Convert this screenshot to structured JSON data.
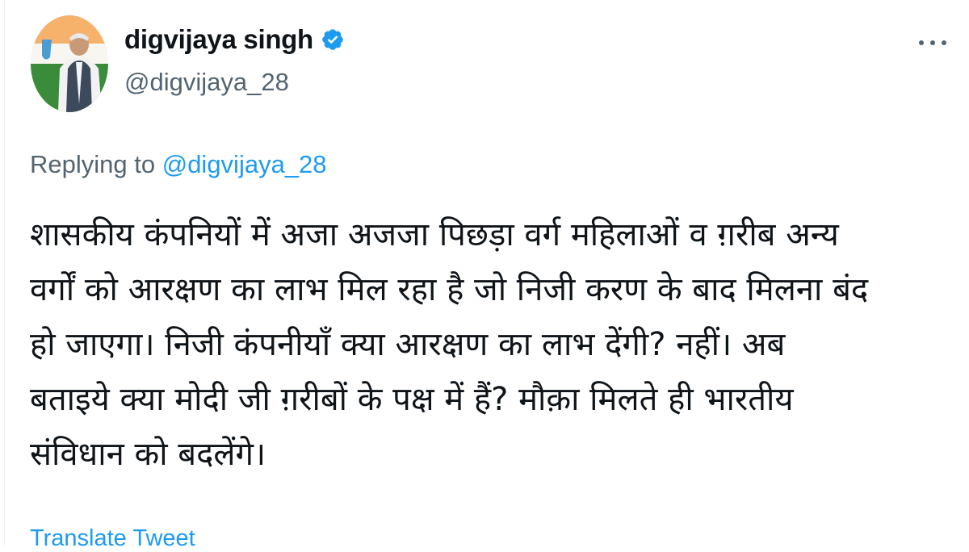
{
  "tweet": {
    "author": {
      "display_name": "digvijaya singh",
      "handle": "@digvijaya_28",
      "verified": true
    },
    "replying_prefix": "Replying to",
    "replying_to": "@digvijaya_28",
    "text": "शासकीय कंपनियों में अजा अजजा पिछड़ा वर्ग महिलाओं व ग़रीब अन्य\nवर्गों को आरक्षण का लाभ मिल रहा है जो निजी करण के बाद मिलना बंद\nहो जाएगा। निजी कंपनीयाँ क्या आरक्षण का लाभ देंगी? नहीं। अब\nबताइये क्या मोदी जी ग़रीबों के पक्ष में हैं? मौक़ा मिलते ही भारतीय\nसंविधान को बदलेंगे।",
    "translate_label": "Translate Tweet"
  },
  "icons": {
    "verified": "verified-badge-icon",
    "more": "more-horizontal-icon"
  },
  "colors": {
    "link": "#1d9bf0",
    "secondary_text": "#536471",
    "primary_text": "#0f1419",
    "verified": "#1d9bf0"
  }
}
